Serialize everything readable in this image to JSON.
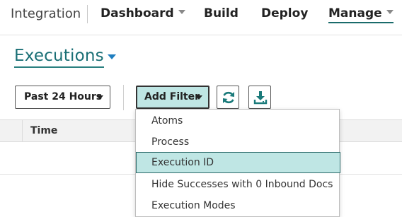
{
  "nav": {
    "brand": "Integration",
    "items": [
      {
        "label": "Dashboard"
      },
      {
        "label": "Build"
      },
      {
        "label": "Deploy"
      },
      {
        "label": "Manage"
      }
    ]
  },
  "page": {
    "title": "Executions"
  },
  "toolbar": {
    "time_range": "Past 24 Hours",
    "add_filter": "Add Filter",
    "icons": [
      "refresh-icon",
      "download-icon"
    ]
  },
  "table": {
    "columns": [
      "",
      "Time"
    ]
  },
  "filter_menu": {
    "items": [
      {
        "label": "Atoms"
      },
      {
        "label": "Process"
      },
      {
        "label": "Execution ID"
      },
      {
        "label": "Hide Successes with 0 Inbound Docs"
      },
      {
        "label": "Execution Modes"
      }
    ],
    "highlighted": "Execution ID"
  },
  "colors": {
    "accent": "#1a6f75",
    "highlight": "#bfe6e4",
    "link_caret": "#1f7ec0"
  }
}
